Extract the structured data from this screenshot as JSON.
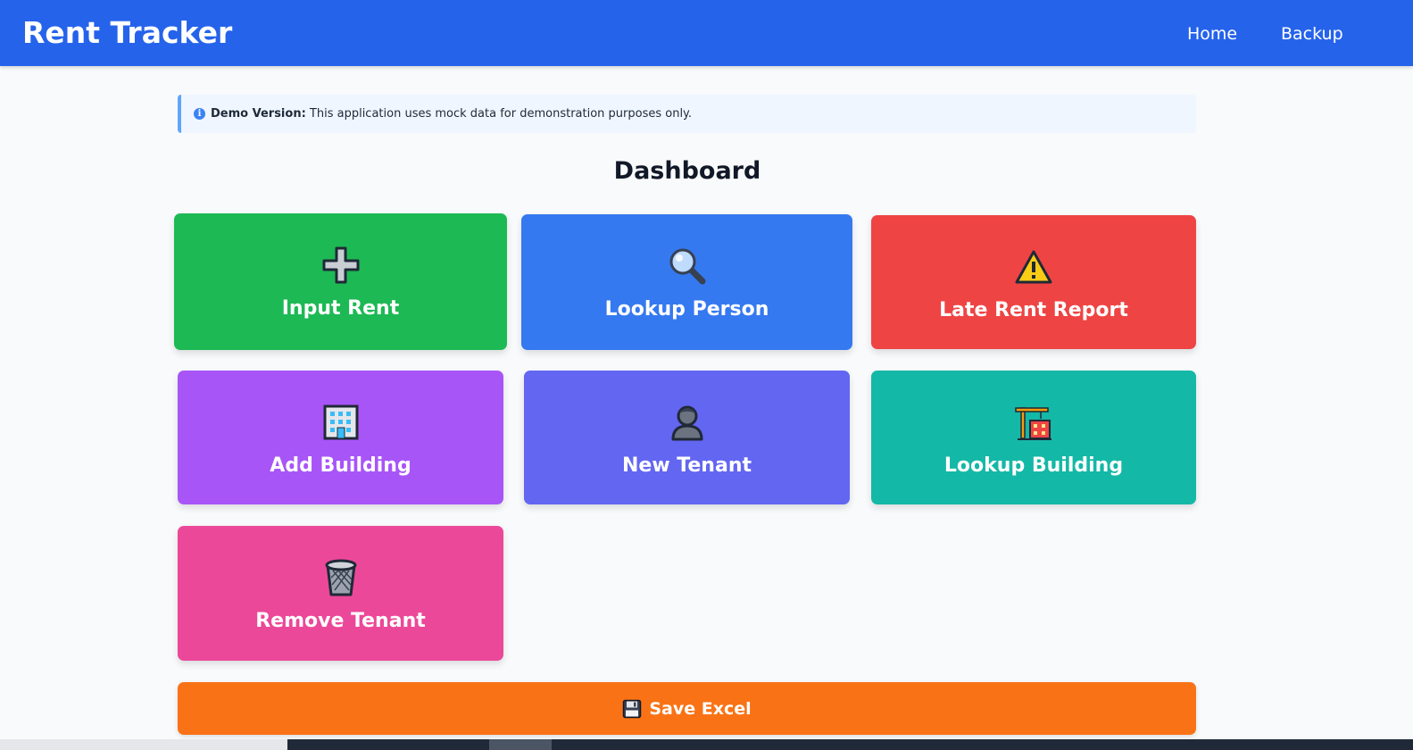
{
  "app": {
    "title": "Rent Tracker"
  },
  "nav": {
    "items": [
      {
        "label": "Home"
      },
      {
        "label": "Backup"
      }
    ]
  },
  "alert": {
    "strong": "Demo Version:",
    "text": " This application uses mock data for demonstration purposes only.",
    "icon": "info-icon"
  },
  "page": {
    "title": "Dashboard"
  },
  "cards": [
    {
      "label": "Input Rent",
      "icon": "plus-icon",
      "color": "#1db954"
    },
    {
      "label": "Lookup Person",
      "icon": "magnifier-icon",
      "color": "#3579f0"
    },
    {
      "label": "Late Rent Report",
      "icon": "warning-icon",
      "color": "#ef4444"
    },
    {
      "label": "Add Building",
      "icon": "office-building-icon",
      "color": "#a855f7"
    },
    {
      "label": "New Tenant",
      "icon": "person-icon",
      "color": "#6366f1"
    },
    {
      "label": "Lookup Building",
      "icon": "construction-crane-icon",
      "color": "#14b8a6"
    },
    {
      "label": "Remove Tenant",
      "icon": "wastebasket-icon",
      "color": "#ec4899"
    }
  ],
  "save": {
    "label": "Save Excel",
    "icon": "floppy-disk-icon",
    "color": "#f97316"
  },
  "colors": {
    "navbar": "#2563eb",
    "background": "#f8fafc",
    "alert_bg": "#eff6ff",
    "alert_border": "#60a5fa"
  }
}
